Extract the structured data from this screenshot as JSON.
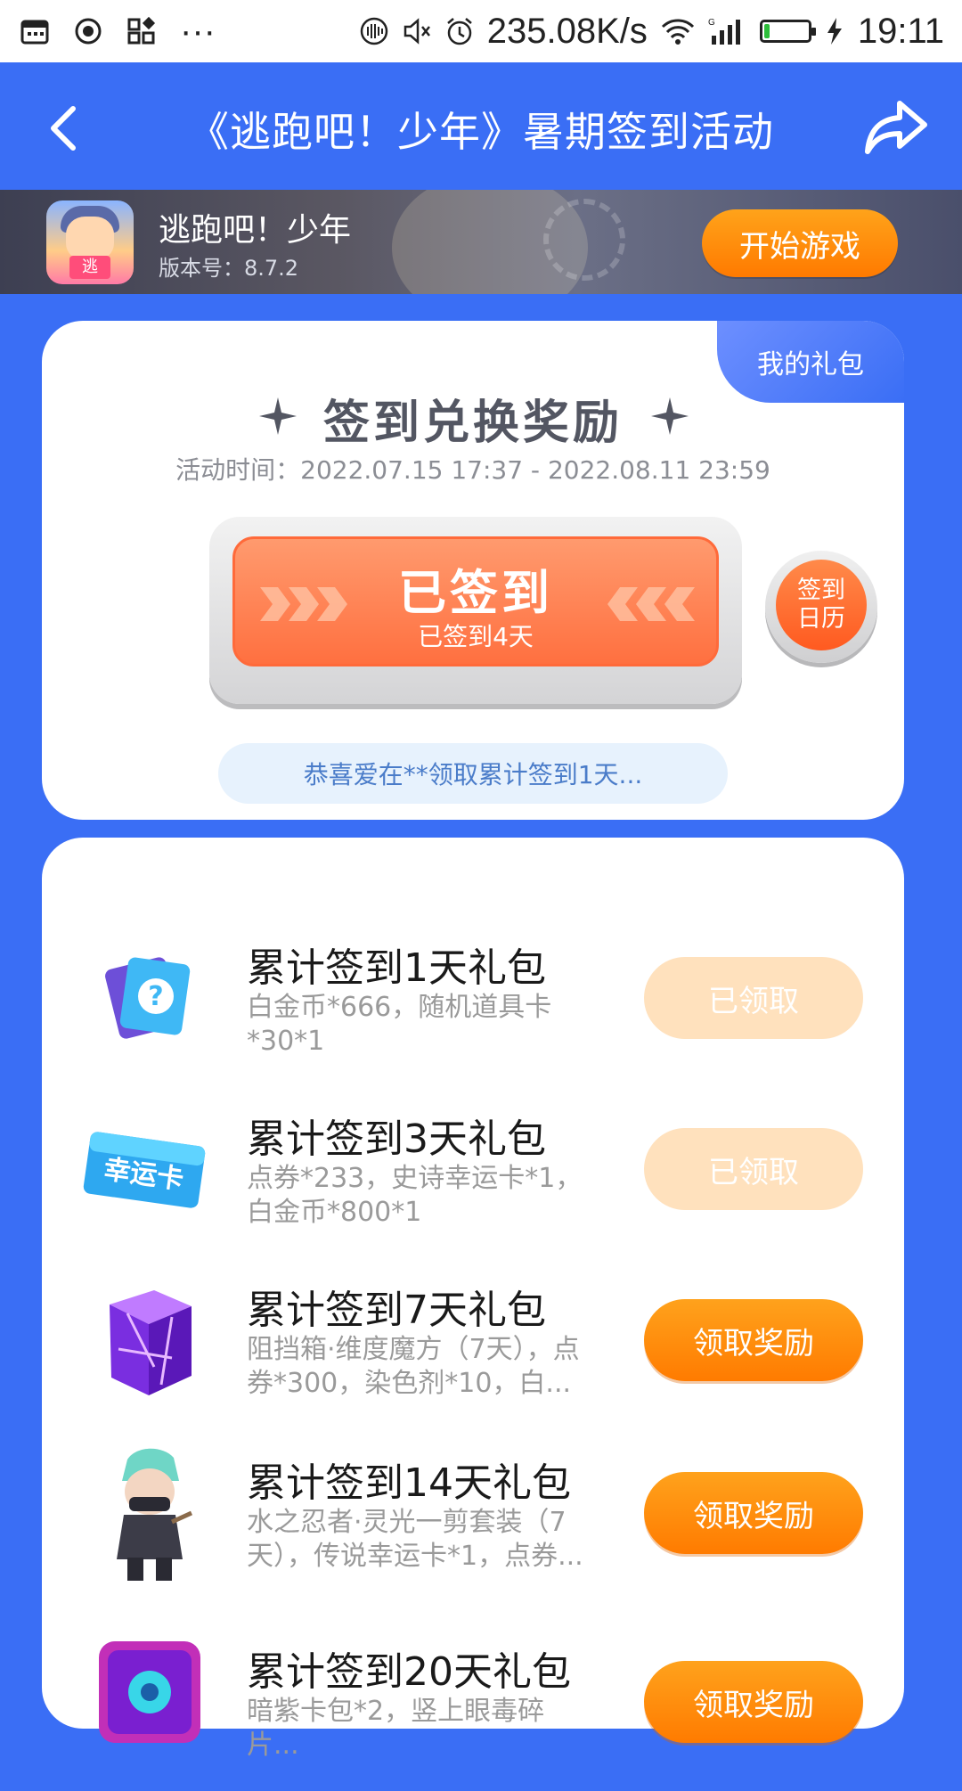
{
  "status_bar": {
    "network_speed": "235.08K/s",
    "time": "19:11",
    "more": "···",
    "battery_level": 0.12
  },
  "header": {
    "title": "《逃跑吧！少年》暑期签到活动"
  },
  "game": {
    "name": "逃跑吧！少年",
    "version": "版本号：8.7.2",
    "icon_sign": "逃",
    "start_label": "开始游戏"
  },
  "signin": {
    "my_gift_tab": "我的礼包",
    "title": "签到兑换奖励",
    "time": "活动时间：2022.07.15 17:37 - 2022.08.11 23:59",
    "status": "已签到",
    "days": "已签到4天",
    "calendar_line1": "签到",
    "calendar_line2": "日历",
    "notice": "恭喜爱在**领取累计签到1天..."
  },
  "gifts": [
    {
      "title": "累计签到1天礼包",
      "desc": "白金币*666，随机道具卡*30*1",
      "button": "已领取",
      "state": "claimed",
      "icon": "question-card-icon"
    },
    {
      "title": "累计签到3天礼包",
      "desc": "点券*233，史诗幸运卡*1，白金币*800*1",
      "button": "已领取",
      "state": "claimed",
      "icon": "lucky-card-icon",
      "icon_text": "幸运卡"
    },
    {
      "title": "累计签到7天礼包",
      "desc": "阻挡箱·维度魔方（7天），点券*300，染色剂*10，白...",
      "button": "领取奖励",
      "state": "available",
      "icon": "purple-cube-icon"
    },
    {
      "title": "累计签到14天礼包",
      "desc": "水之忍者·灵光一剪套装（7天），传说幸运卡*1，点券...",
      "button": "领取奖励",
      "state": "available",
      "icon": "ninja-character-icon"
    },
    {
      "title": "累计签到20天礼包",
      "desc": "暗紫卡包*2，竖上眼毒碎片...",
      "button": "领取奖励",
      "state": "available",
      "icon": "card-pack-icon"
    }
  ],
  "colors": {
    "primary_blue": "#3a6ef5",
    "orange": "#ff7b00",
    "claimed": "#ffe1bd"
  }
}
